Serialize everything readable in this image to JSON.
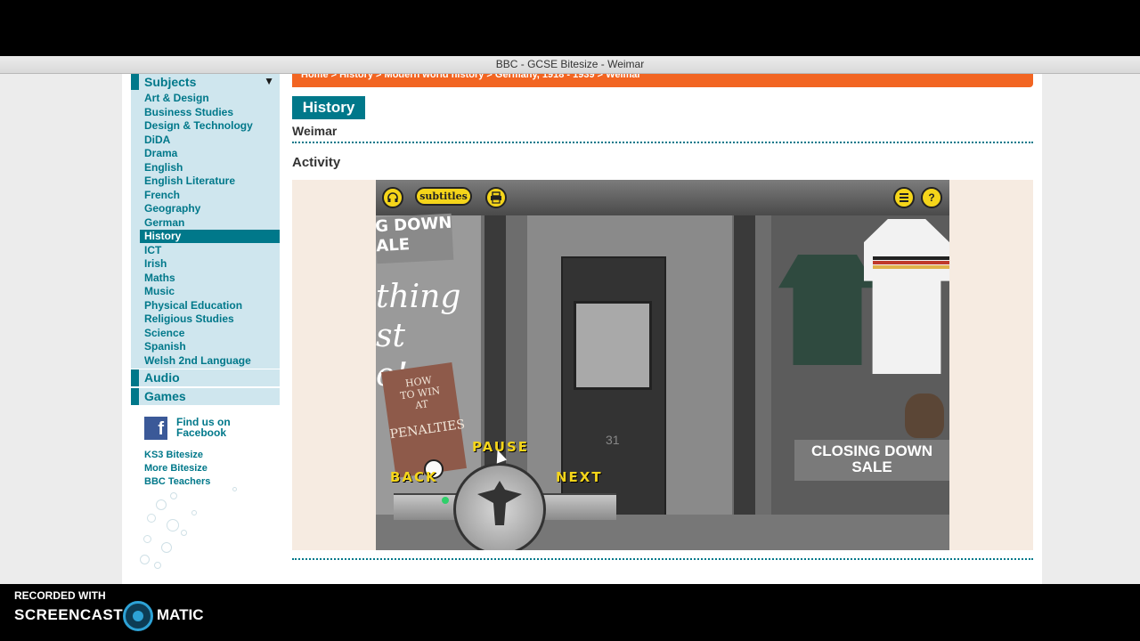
{
  "window": {
    "title": "BBC - GCSE Bitesize - Weimar"
  },
  "sidebar": {
    "subjects_label": "Subjects",
    "subjects_arrow": "▼",
    "items": [
      {
        "label": "Art & Design"
      },
      {
        "label": "Business Studies"
      },
      {
        "label": "Design & Technology"
      },
      {
        "label": "DiDA"
      },
      {
        "label": "Drama"
      },
      {
        "label": "English"
      },
      {
        "label": "English Literature"
      },
      {
        "label": "French"
      },
      {
        "label": "Geography"
      },
      {
        "label": "German"
      },
      {
        "label": "History"
      },
      {
        "label": "ICT"
      },
      {
        "label": "Irish"
      },
      {
        "label": "Maths"
      },
      {
        "label": "Music"
      },
      {
        "label": "Physical Education"
      },
      {
        "label": "Religious Studies"
      },
      {
        "label": "Science"
      },
      {
        "label": "Spanish"
      },
      {
        "label": "Welsh 2nd Language"
      }
    ],
    "active_item": "History",
    "audio_label": "Audio",
    "games_label": "Games",
    "facebook_icon": "f",
    "facebook_line1": "Find us on",
    "facebook_line2": "Facebook",
    "links": [
      "KS3 Bitesize",
      "More Bitesize",
      "BBC Teachers"
    ]
  },
  "breadcrumb": {
    "text": "Home  >  History  >  Modern world history  >  Germany, 1918 - 1939  >  Weimar"
  },
  "main": {
    "section_title": "History",
    "topic": "Weimar",
    "activity_heading": "Activity"
  },
  "game": {
    "subtitles_label": "subtitles",
    "headphones_icon": "headphones-icon",
    "print_icon": "print-icon",
    "menu_icon": "menu-icon",
    "help_label": "?",
    "sign_top": "G DOWN\nALE",
    "script_text": "thing\nst\no!",
    "book_line1": "HOW\nTO WIN\nAT",
    "book_line2": "PENALTIES",
    "door_number": "31",
    "closing_sign": "CLOSING DOWN\nSALE",
    "pause_label": "PAUSE",
    "back_label": "BACK",
    "next_label": "NEXT"
  },
  "recorder": {
    "small": "RECORDED WITH",
    "big": "SCREENCAST",
    "brand": "MATIC"
  }
}
